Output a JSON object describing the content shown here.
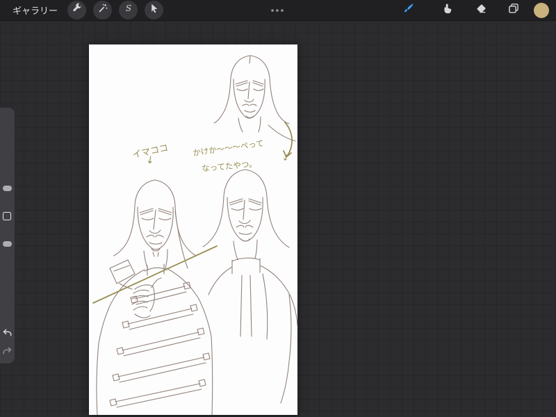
{
  "topbar": {
    "gallery_label": "ギャラリー",
    "menu_dots": "•••",
    "selection_glyph": "S",
    "tools_left": [
      "actions-wrench",
      "adjustments-wand",
      "selection-s",
      "transform-arrow"
    ],
    "tools_right": [
      "paint-brush",
      "smudge-finger",
      "eraser",
      "layers",
      "color-swatch"
    ],
    "selected_tool": "paint-brush"
  },
  "sidebar": {
    "controls": [
      "brush-size-slider",
      "modify-button",
      "opacity-slider",
      "undo",
      "redo"
    ]
  },
  "canvas": {
    "annotations": {
      "ima_koko": "イマココ",
      "arrow_down_1": "↓",
      "note_line1": "かけか〜〜〜ぺって",
      "note_line2": "なってたやつ。",
      "arrow_down_2": "↓"
    }
  },
  "colors": {
    "accent_blue": "#3fa2ff",
    "color_swatch": "#c9b27c",
    "annotation_olive": "#988f55",
    "sketch_line": "#77635a",
    "icon_gray": "#d6d6d8"
  }
}
